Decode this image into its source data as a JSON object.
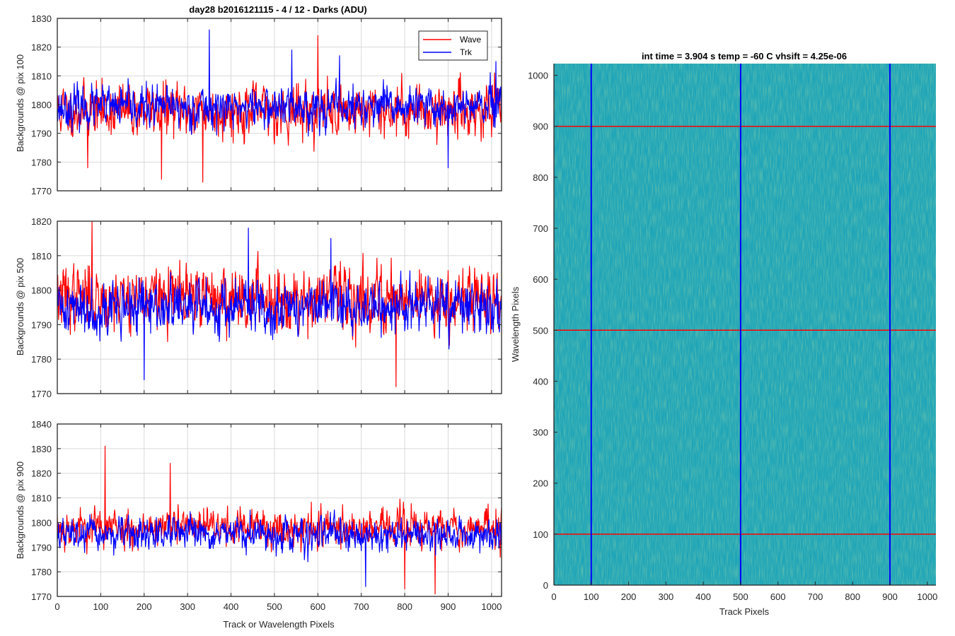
{
  "figure": {
    "left_title": "day28 b2016121115 - 4 / 12 - Darks (ADU)",
    "right_title": "int time = 3.904 s   temp = -60 C   vhsift = 4.25e-06",
    "colors": {
      "wave": "#ff0000",
      "trk": "#0000ff",
      "grid": "#d9d9d9",
      "axis": "#262626"
    }
  },
  "chart_data": [
    {
      "type": "line",
      "panel": "top",
      "ylabel": "Backgrounds @ pix 100",
      "xlabel": "",
      "xlim": [
        0,
        1023
      ],
      "ylim": [
        1770,
        1830
      ],
      "xticks": [
        0,
        100,
        200,
        300,
        400,
        500,
        600,
        700,
        800,
        900,
        1000
      ],
      "yticks": [
        1770,
        1780,
        1790,
        1800,
        1810,
        1820,
        1830
      ],
      "xticklabels_visible": false,
      "grid": true,
      "legend": {
        "placement": "top-right",
        "entries": [
          "Wave",
          "Trk"
        ]
      },
      "series": [
        {
          "name": "Wave",
          "color": "#ff0000",
          "n_points": 1024,
          "mean": 1798,
          "spread": 6.5,
          "min": 1773,
          "max": 1824,
          "seed": 11,
          "features": [
            [
              70,
              1778
            ],
            [
              240,
              1774
            ],
            [
              335,
              1773
            ],
            [
              600,
              1824
            ]
          ]
        },
        {
          "name": "Trk",
          "color": "#0000ff",
          "n_points": 1024,
          "mean": 1799,
          "spread": 5.0,
          "min": 1778,
          "max": 1826,
          "seed": 23,
          "features": [
            [
              350,
              1826
            ],
            [
              540,
              1819
            ],
            [
              650,
              1817
            ],
            [
              900,
              1778
            ],
            [
              1010,
              1815
            ]
          ]
        }
      ]
    },
    {
      "type": "line",
      "panel": "middle",
      "ylabel": "Backgrounds @ pix 500",
      "xlabel": "",
      "xlim": [
        0,
        1023
      ],
      "ylim": [
        1770,
        1820
      ],
      "xticks": [
        0,
        100,
        200,
        300,
        400,
        500,
        600,
        700,
        800,
        900,
        1000
      ],
      "yticks": [
        1770,
        1780,
        1790,
        1800,
        1810,
        1820
      ],
      "xticklabels_visible": false,
      "grid": true,
      "series": [
        {
          "name": "Wave",
          "color": "#ff0000",
          "n_points": 1024,
          "mean": 1798,
          "spread": 6.5,
          "min": 1772,
          "max": 1820,
          "seed": 37,
          "features": [
            [
              80,
              1820
            ],
            [
              780,
              1772
            ]
          ]
        },
        {
          "name": "Trk",
          "color": "#0000ff",
          "n_points": 1024,
          "mean": 1795,
          "spread": 5.5,
          "min": 1774,
          "max": 1818,
          "seed": 41,
          "features": [
            [
              200,
              1774
            ],
            [
              440,
              1818
            ],
            [
              630,
              1815
            ]
          ]
        }
      ]
    },
    {
      "type": "line",
      "panel": "bottom",
      "ylabel": "Backgrounds @ pix 900",
      "xlabel": "Track or Wavelength Pixels",
      "xlim": [
        0,
        1023
      ],
      "ylim": [
        1770,
        1840
      ],
      "xticks": [
        0,
        100,
        200,
        300,
        400,
        500,
        600,
        700,
        800,
        900,
        1000
      ],
      "yticks": [
        1770,
        1780,
        1790,
        1800,
        1810,
        1820,
        1830,
        1840
      ],
      "xticklabels_visible": true,
      "grid": true,
      "series": [
        {
          "name": "Wave",
          "color": "#ff0000",
          "n_points": 1024,
          "mean": 1798,
          "spread": 5.5,
          "min": 1771,
          "max": 1831,
          "seed": 53,
          "features": [
            [
              110,
              1831
            ],
            [
              260,
              1824
            ],
            [
              800,
              1773
            ],
            [
              870,
              1771
            ]
          ]
        },
        {
          "name": "Trk",
          "color": "#0000ff",
          "n_points": 1024,
          "mean": 1795,
          "spread": 4.5,
          "min": 1774,
          "max": 1812,
          "seed": 67,
          "features": [
            [
              710,
              1774
            ]
          ]
        }
      ]
    },
    {
      "type": "heatmap",
      "panel": "image",
      "xlabel": "Track Pixels",
      "ylabel": "Wavelength Pixels",
      "xlim": [
        0,
        1023
      ],
      "ylim": [
        0,
        1023
      ],
      "xticks": [
        0,
        100,
        200,
        300,
        400,
        500,
        600,
        700,
        800,
        900,
        1000
      ],
      "yticks": [
        0,
        100,
        200,
        300,
        400,
        500,
        600,
        700,
        800,
        900,
        1000
      ],
      "colormap": "parula",
      "base_color": "#1fa5b8",
      "vertical_lines": {
        "x": [
          100,
          500,
          900
        ],
        "color": "#0000ff"
      },
      "horizontal_lines": {
        "y": [
          100,
          500,
          900
        ],
        "color": "#ff0000"
      }
    }
  ]
}
